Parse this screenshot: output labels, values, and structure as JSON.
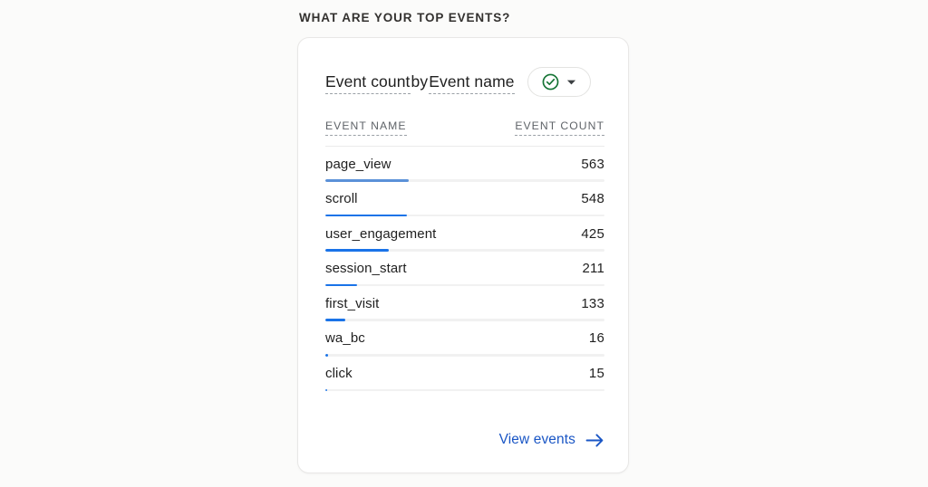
{
  "section": {
    "heading": "WHAT ARE YOUR TOP EVENTS?"
  },
  "card": {
    "title": {
      "metric": "Event count",
      "connector": "by",
      "dimension": "Event name"
    },
    "selector": {
      "check_icon": "check-circle-icon",
      "chevron_icon": "chevron-down-icon",
      "accent_color": "#137333"
    },
    "table": {
      "columns": [
        "EVENT NAME",
        "EVENT COUNT"
      ],
      "rows": [
        {
          "name": "page_view",
          "count": "563"
        },
        {
          "name": "scroll",
          "count": "548"
        },
        {
          "name": "user_engagement",
          "count": "425"
        },
        {
          "name": "session_start",
          "count": "211"
        },
        {
          "name": "first_visit",
          "count": "133"
        },
        {
          "name": "wa_bc",
          "count": "16"
        },
        {
          "name": "click",
          "count": "15"
        }
      ]
    },
    "footer": {
      "link_label": "View events",
      "arrow_icon": "arrow-right-icon",
      "link_color": "#1a56c5"
    }
  },
  "chart_data": {
    "type": "bar",
    "title": "Event count by Event name",
    "xlabel": "Event count",
    "ylabel": "Event name",
    "categories": [
      "page_view",
      "scroll",
      "user_engagement",
      "session_start",
      "first_visit",
      "wa_bc",
      "click"
    ],
    "values": [
      563,
      548,
      425,
      211,
      133,
      16,
      15
    ],
    "max_value": 563,
    "bar_color": "#1a73e8",
    "track_color": "#f1f1f1",
    "grid": false,
    "legend": false
  }
}
